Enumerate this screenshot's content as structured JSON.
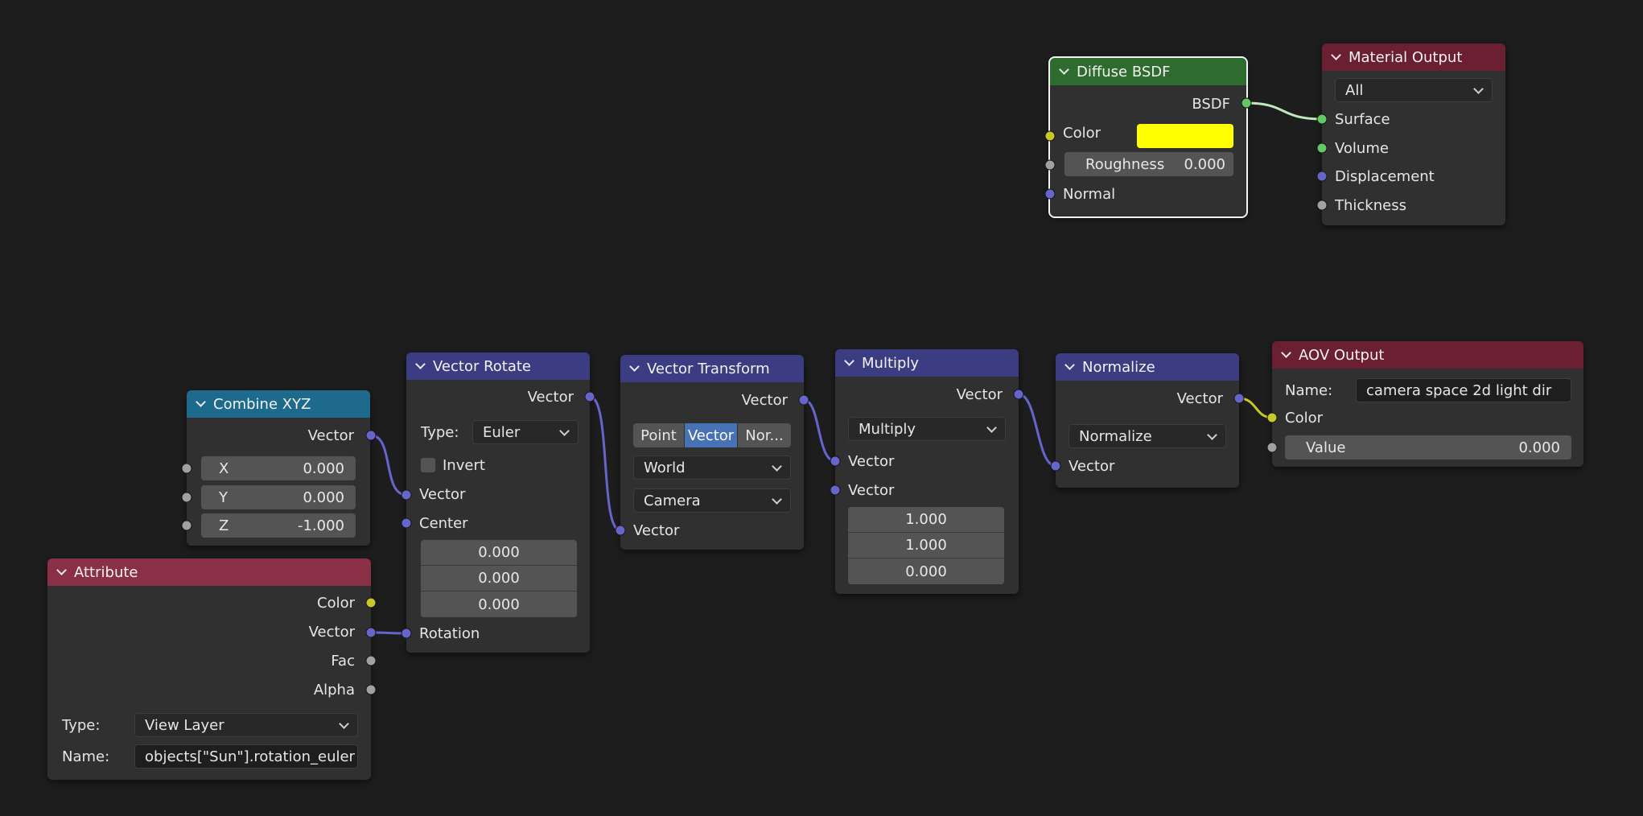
{
  "colors": {
    "background": "#1d1d1d",
    "node_body": "#303030",
    "header_input": "#1e6a8c",
    "header_vector": "#3c3c83",
    "header_shader": "#2e6b2e",
    "header_output": "#6b1f32",
    "header_attribute": "#8a3046",
    "socket_vector": "#6565cc",
    "socket_color": "#c7c729",
    "socket_float": "#a1a1a1",
    "socket_shader": "#63c763",
    "swatch_yellow": "#ffff00",
    "toggle_active": "#4772b3"
  },
  "nodes": {
    "combine_xyz": {
      "title": "Combine XYZ",
      "output": "Vector",
      "x_label": "X",
      "x_value": "0.000",
      "y_label": "Y",
      "y_value": "0.000",
      "z_label": "Z",
      "z_value": "-1.000"
    },
    "attribute": {
      "title": "Attribute",
      "outputs": [
        "Color",
        "Vector",
        "Fac",
        "Alpha"
      ],
      "type_label": "Type:",
      "type_value": "View Layer",
      "name_label": "Name:",
      "name_value": "objects[\"Sun\"].rotation_euler"
    },
    "vector_rotate": {
      "title": "Vector Rotate",
      "output": "Vector",
      "type_label": "Type:",
      "type_value": "Euler",
      "invert_label": "Invert",
      "input_vector": "Vector",
      "input_center": "Center",
      "center_values": [
        "0.000",
        "0.000",
        "0.000"
      ],
      "input_rotation": "Rotation"
    },
    "vector_transform": {
      "title": "Vector Transform",
      "output": "Vector",
      "modes": [
        "Point",
        "Vector",
        "Nor..."
      ],
      "active_mode": "Vector",
      "from_value": "World",
      "to_value": "Camera",
      "input_vector": "Vector"
    },
    "multiply": {
      "title": "Multiply",
      "output": "Vector",
      "operation": "Multiply",
      "input_a": "Vector",
      "input_b": "Vector",
      "b_values": [
        "1.000",
        "1.000",
        "0.000"
      ]
    },
    "normalize": {
      "title": "Normalize",
      "output": "Vector",
      "operation": "Normalize",
      "input_vector": "Vector"
    },
    "aov_output": {
      "title": "AOV Output",
      "name_label": "Name:",
      "name_value": "camera space 2d light dir",
      "input_color": "Color",
      "value_label": "Value",
      "value_value": "0.000"
    },
    "diffuse_bsdf": {
      "title": "Diffuse BSDF",
      "output": "BSDF",
      "input_color": "Color",
      "roughness_label": "Roughness",
      "roughness_value": "0.000",
      "input_normal": "Normal"
    },
    "material_output": {
      "title": "Material Output",
      "target": "All",
      "inputs": [
        "Surface",
        "Volume",
        "Displacement",
        "Thickness"
      ]
    }
  }
}
